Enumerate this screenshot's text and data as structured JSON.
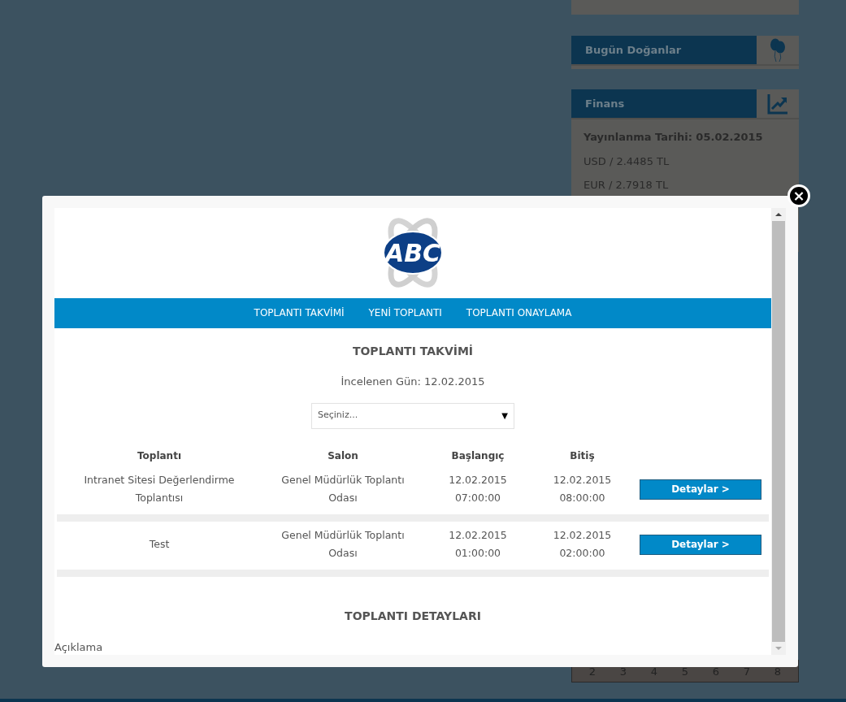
{
  "sidebar": {
    "widgets": [
      {
        "kind": "blank"
      },
      {
        "kind": "birthdays",
        "title": "Bugün Doğanlar"
      },
      {
        "kind": "finance",
        "title": "Finans",
        "published": "Yayınlanma Tarihi: 05.02.2015",
        "rates": [
          "USD / 2.4485 TL",
          "EUR / 2.7918 TL"
        ]
      }
    ],
    "calendar_days": [
      "2",
      "3",
      "4",
      "5",
      "6",
      "7",
      "8"
    ]
  },
  "modal": {
    "logo": "ABC",
    "nav": [
      "TOPLANTI TAKVİMİ",
      "YENİ TOPLANTI",
      "TOPLANTI ONAYLAMA"
    ],
    "title": "TOPLANTI TAKVİMİ",
    "day": "İncelenen Gün: 12.02.2015",
    "select": {
      "placeholder": "Seçiniz...",
      "arrow": "▼"
    },
    "table": {
      "columns": [
        "Toplantı",
        "Salon",
        "Başlangıç",
        "Bitiş"
      ],
      "rows": [
        {
          "meeting": "Intranet Sitesi Değerlendirme Toplantısı",
          "room": "Genel Müdürlük Toplantı Odası",
          "start": [
            "12.02.2015",
            "07:00:00"
          ],
          "end": [
            "12.02.2015",
            "08:00:00"
          ],
          "button": "Detaylar >"
        },
        {
          "meeting": "Test",
          "room": "Genel Müdürlük Toplantı Odası",
          "start": [
            "12.02.2015",
            "01:00:00"
          ],
          "end": [
            "12.02.2015",
            "02:00:00"
          ],
          "button": "Detaylar >"
        }
      ]
    },
    "details_title": "TOPLANTI DETAYLARI",
    "description_label": "Açıklama",
    "close": "×"
  }
}
